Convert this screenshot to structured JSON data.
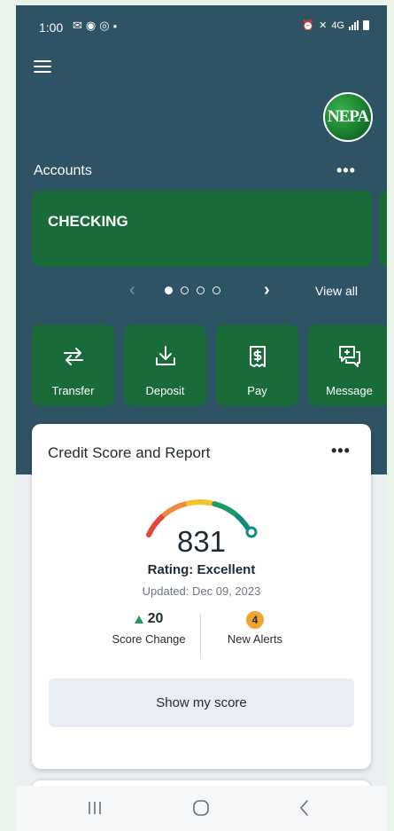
{
  "status_bar": {
    "time": "1:00",
    "network": "4G"
  },
  "header": {
    "logo_text": "NEPA"
  },
  "accounts": {
    "title": "Accounts",
    "more_label": "•••",
    "cards": [
      {
        "label": "CHECKING"
      }
    ],
    "pager": {
      "prev": "‹",
      "next": "›",
      "view_all": "View all",
      "page_count": 4,
      "active_page": 1
    }
  },
  "quick_actions": [
    {
      "label": "Transfer",
      "icon": "transfer-icon"
    },
    {
      "label": "Deposit",
      "icon": "deposit-icon"
    },
    {
      "label": "Pay",
      "icon": "pay-icon"
    },
    {
      "label": "Message",
      "icon": "message-icon"
    }
  ],
  "credit_score": {
    "title": "Credit Score and Report",
    "more_label": "•••",
    "score": "831",
    "rating": "Rating: Excellent",
    "updated": "Updated: Dec 09, 2023",
    "score_change_value": "20",
    "score_change_label": "Score Change",
    "alerts_value": "4",
    "alerts_label": "New Alerts",
    "button_label": "Show my score",
    "gauge_colors": [
      "#e0473a",
      "#f08a3a",
      "#f4c227",
      "#1e9b62",
      "#128a7f"
    ]
  },
  "colors": {
    "hero_bg": "#2e5364",
    "accent_green": "#1a6b3a",
    "badge_orange": "#f1a52f"
  }
}
